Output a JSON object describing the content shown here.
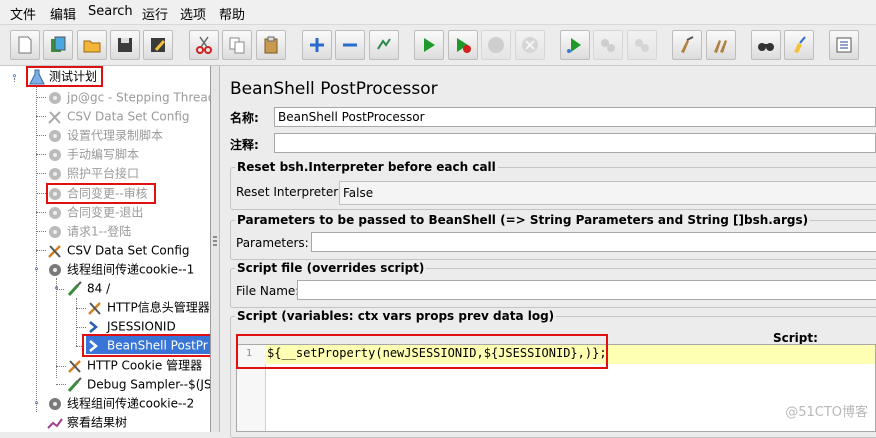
{
  "menubar": {
    "items": [
      "文件",
      "编辑",
      "Search",
      "运行",
      "选项",
      "帮助"
    ]
  },
  "toolbar": {
    "buttons": [
      "new-icon",
      "templates-icon",
      "open-icon",
      "save-icon",
      "save-as-icon",
      "cut-icon",
      "copy-icon",
      "paste-icon",
      "expand-icon",
      "collapse-icon",
      "toggle-icon",
      "start-icon",
      "start-no-pause-icon",
      "stop-icon",
      "shutdown-icon",
      "remote-start-icon",
      "remote-stop-icon",
      "remote-shutdown-icon",
      "clear-icon",
      "clear-all-icon",
      "search-icon",
      "reset-search-icon",
      "function-helper-icon"
    ]
  },
  "tree": {
    "nodes": [
      {
        "label": "测试计划",
        "state": "normal"
      },
      {
        "label": "jp@gc - Stepping Thread",
        "state": "disabled"
      },
      {
        "label": "CSV Data Set Config",
        "state": "disabled"
      },
      {
        "label": "设置代理录制脚本",
        "state": "disabled"
      },
      {
        "label": "手动编写脚本",
        "state": "disabled"
      },
      {
        "label": "照护平台接口",
        "state": "disabled"
      },
      {
        "label": "合同变更--审核",
        "state": "disabled"
      },
      {
        "label": "合同变更-退出",
        "state": "disabled"
      },
      {
        "label": "请求1--登陆",
        "state": "disabled"
      },
      {
        "label": "CSV Data Set Config",
        "state": "normal"
      },
      {
        "label": "线程组间传递cookie--1",
        "state": "normal"
      },
      {
        "label": "84 /",
        "state": "normal"
      },
      {
        "label": "HTTP信息头管理器",
        "state": "normal"
      },
      {
        "label": "JSESSIONID",
        "state": "normal"
      },
      {
        "label": "BeanShell PostPr",
        "state": "selected"
      },
      {
        "label": "HTTP Cookie 管理器",
        "state": "normal"
      },
      {
        "label": "Debug Sampler--$(JS",
        "state": "normal"
      },
      {
        "label": "线程组间传递cookie--2",
        "state": "normal"
      },
      {
        "label": "察看结果树",
        "state": "normal"
      }
    ]
  },
  "panel": {
    "title": "BeanShell PostProcessor",
    "name_label": "名称:",
    "name_value": "BeanShell PostProcessor",
    "comment_label": "注释:",
    "comment_value": "",
    "reset_group_title": "Reset bsh.Interpreter before each call",
    "reset_label": "Reset Interpreter:",
    "reset_value": "False",
    "params_group_title": "Parameters to be passed to BeanShell (=> String Parameters and String []bsh.args)",
    "params_label": "Parameters:",
    "params_value": "",
    "file_group_title": "Script file (overrides script)",
    "file_label": "File Name:",
    "file_value": "",
    "script_group_title": "Script (variables: ctx vars props prev data log)",
    "script_label": "Script:",
    "line_number": "1",
    "code": "${__setProperty(newJSESSIONID,${JSESSIONID},)};"
  },
  "watermark": "@51CTO博客",
  "colors": {
    "highlight_box": "#e01010",
    "selection": "#3875d7",
    "line_highlight": "#ffffb3"
  }
}
